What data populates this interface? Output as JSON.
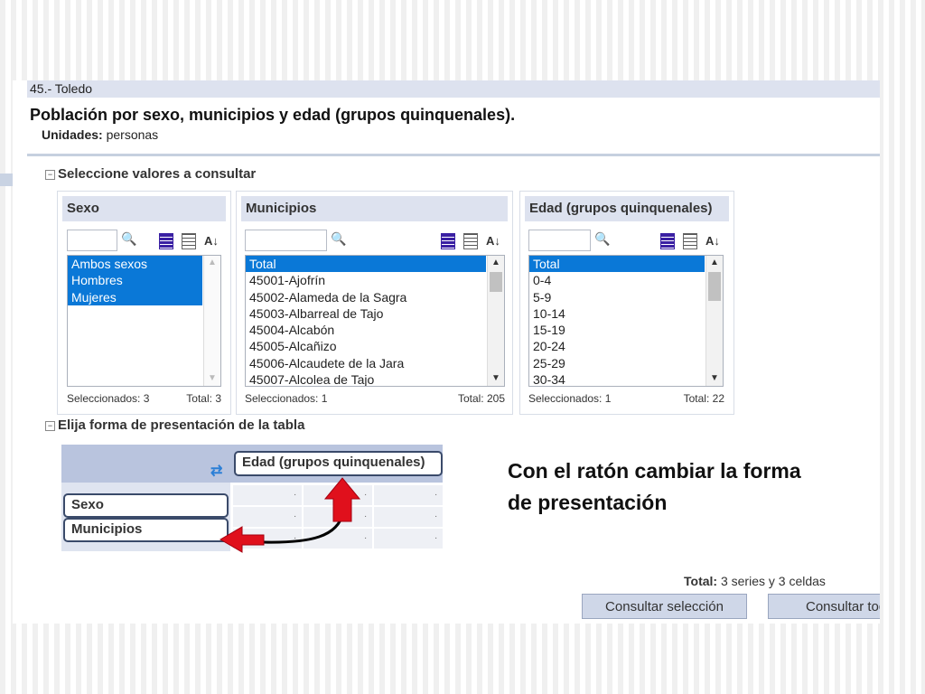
{
  "header": {
    "breadcrumb": "45.- Toledo",
    "title": "Población por sexo, municipios y edad (grupos quinquenales).",
    "units_label": "Unidades:",
    "units_value": "personas"
  },
  "section_select": {
    "toggle": "−",
    "label": "Seleccione valores a consultar"
  },
  "panels": {
    "sexo": {
      "title": "Sexo",
      "items": [
        "Ambos sexos",
        "Hombres",
        "Mujeres"
      ],
      "selected_count": "Seleccionados: 3",
      "total": "Total: 3"
    },
    "municipios": {
      "title": "Municipios",
      "items": [
        "Total",
        "45001-Ajofrín",
        "45002-Alameda de la Sagra",
        "45003-Albarreal de Tajo",
        "45004-Alcabón",
        "45005-Alcañizo",
        "45006-Alcaudete de la Jara",
        "45007-Alcolea de Tajo"
      ],
      "selected_count": "Seleccionados: 1",
      "total": "Total: 205"
    },
    "edad": {
      "title": "Edad (grupos quinquenales)",
      "items": [
        "Total",
        "0-4",
        "5-9",
        "10-14",
        "15-19",
        "20-24",
        "25-29",
        "30-34"
      ],
      "selected_count": "Seleccionados: 1",
      "total": "Total: 22"
    }
  },
  "section_layout": {
    "toggle": "−",
    "label": "Elija forma de presentación de la tabla"
  },
  "layout": {
    "column_pill": "Edad (grupos quinquenales)",
    "row_pills": [
      "Sexo",
      "Municipios"
    ],
    "cell_value": "."
  },
  "instruction": "Con el ratón cambiar la forma de presentación",
  "summary": {
    "label": "Total:",
    "value": "3 series y 3 celdas"
  },
  "buttons": {
    "consult_selection": "Consultar selección",
    "consult_all": "Consultar todo"
  },
  "colors": {
    "selected": "#0a78d7",
    "header_bg": "#dde2ef",
    "arrow": "#e0101c"
  }
}
